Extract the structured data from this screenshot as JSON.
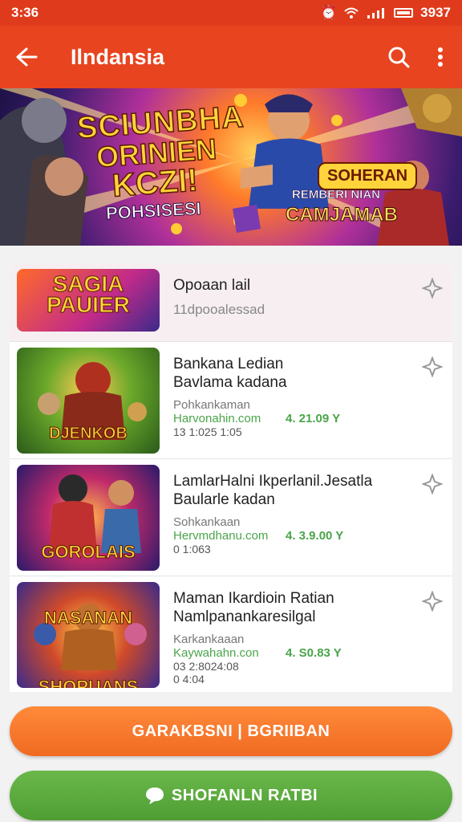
{
  "status_bar": {
    "time": "3:36",
    "battery_text": "3937"
  },
  "app_bar": {
    "title": "Ilndansia"
  },
  "banner": {
    "line1": "SCIUNBHA",
    "line2": "ORINIEN",
    "line3": "KCZI!",
    "line4": "POHSISESI",
    "badge": "SOHERAN",
    "line5": "REMBERI NIAN",
    "line6": "CAMJAMAB"
  },
  "list": {
    "items": [
      {
        "title": "Opoaan lail",
        "subtitle": "11dpooalessad",
        "thumb_text": "SAGIA\nPAUIER"
      },
      {
        "title": "Bankana Ledian\nBavlama kadana",
        "meta": "Pohkankaman",
        "link": "Harvonahin.com",
        "price": "4. 21.09 Y",
        "date": "13 1:025 1:05",
        "thumb_text": "DJENKOB"
      },
      {
        "title": "LamlarHalni Ikperlanil.Jesatla\nBaularle kadan",
        "meta": "Sohkankaan",
        "link": "Hervmdhanu.com",
        "price": "4. 3.9.00 Y",
        "date": "0 1:063",
        "thumb_text": "GOROLAIS"
      },
      {
        "title": "Maman Ikardioin Ratian\nNamlpanankaresilgal",
        "meta": "Karkankaaan",
        "link": "Kaywahahn.con",
        "price": "4. S0.83 Y",
        "date": "03 2:8024:08",
        "date2": "0 4:04",
        "thumb_text": "NASANAN\nSHOPUANS"
      }
    ]
  },
  "buttons": {
    "primary": "GARAKBSNI | BGRIIBAN",
    "secondary": "SHOFANLN RATBI"
  },
  "colors": {
    "appbar": "#e8441f",
    "statusbar": "#e03a1c",
    "primary_button": "#f47a2c",
    "secondary_button": "#5aa83c",
    "price_green": "#4aa54a"
  }
}
